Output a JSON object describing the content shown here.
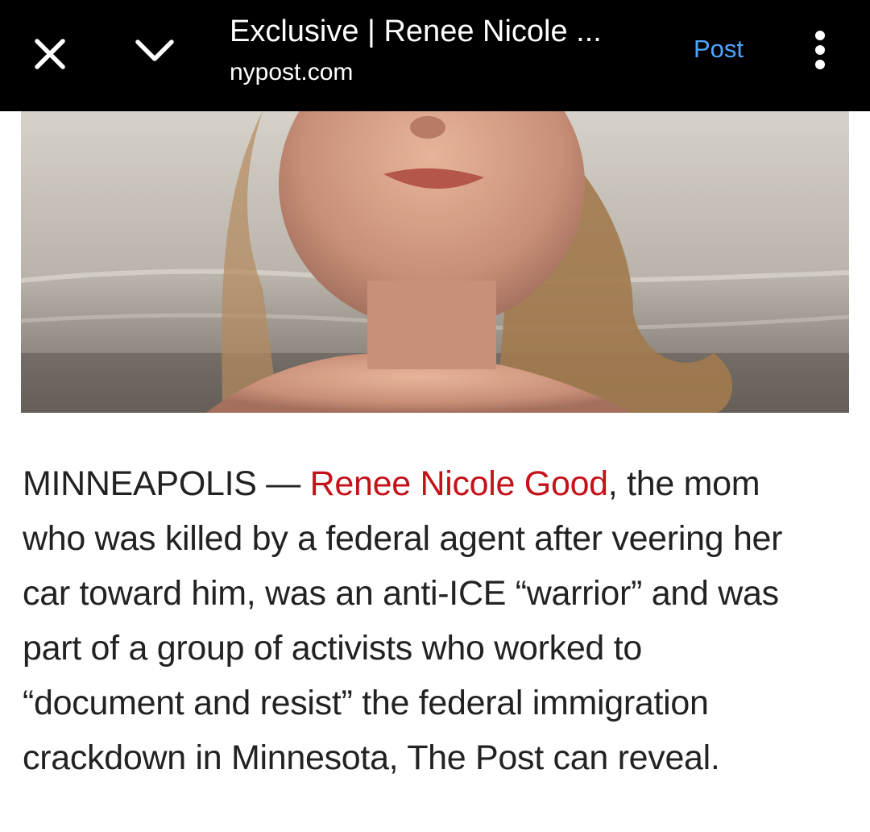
{
  "header": {
    "title": "Exclusive | Renee Nicole ...",
    "domain": "nypost.com",
    "post_label": "Post",
    "icons": {
      "close": "close-icon",
      "collapse": "chevron-down-icon",
      "more": "more-vertical-icon"
    },
    "accent_color": "#4ea6ff"
  },
  "article": {
    "dateline": "MINNEAPOLIS — ",
    "link_text": "Renee Nicole Good",
    "link_color": "#c4121a",
    "lines": [
      ", the mom",
      "who was killed by a federal agent after veering her",
      "car toward him, was an anti-ICE “warrior” and was",
      "part of a group of activists who worked to",
      "“document and resist” the federal immigration",
      "crackdown in Minnesota, The Post can reveal."
    ]
  }
}
